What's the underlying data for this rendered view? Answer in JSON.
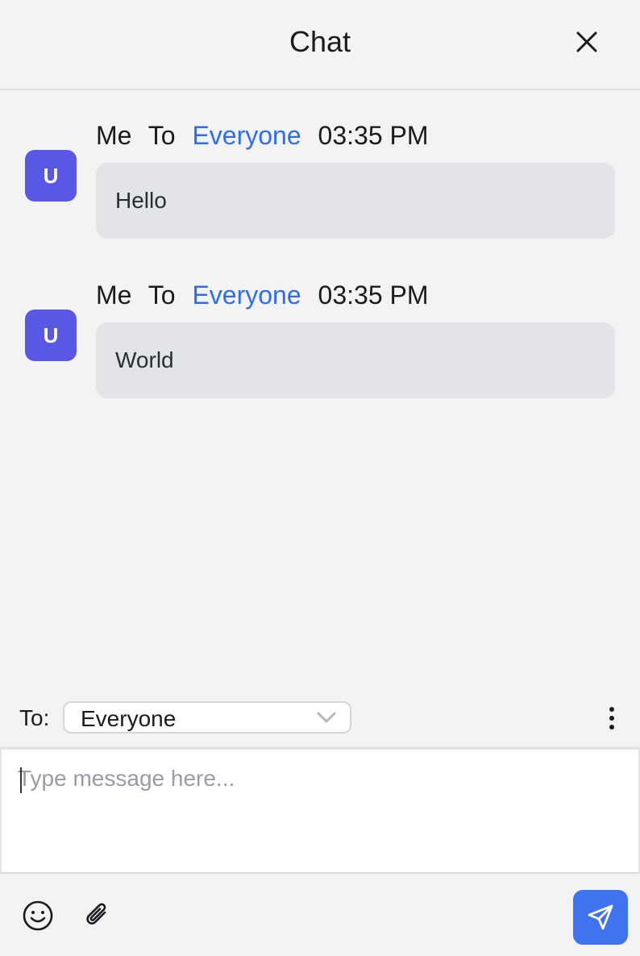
{
  "header": {
    "title": "Chat",
    "close_icon": "close-icon"
  },
  "messages": [
    {
      "avatar_initial": "U",
      "sender": "Me",
      "to_word": "To",
      "recipient": "Everyone",
      "time": "03:35 PM",
      "text": "Hello"
    },
    {
      "avatar_initial": "U",
      "sender": "Me",
      "to_word": "To",
      "recipient": "Everyone",
      "time": "03:35 PM",
      "text": "World"
    }
  ],
  "recipient_row": {
    "label": "To:",
    "selected": "Everyone"
  },
  "composer": {
    "value": "",
    "placeholder": "Type message here..."
  },
  "toolbar": {
    "emoji_icon": "emoji-icon",
    "attach_icon": "paperclip-icon",
    "send_icon": "send-icon"
  },
  "colors": {
    "accent": "#3f73ef",
    "avatar": "#5b57e6",
    "recipient_link": "#2f6df0",
    "bubble": "#e3e4e8",
    "background": "#f3f3f4"
  }
}
